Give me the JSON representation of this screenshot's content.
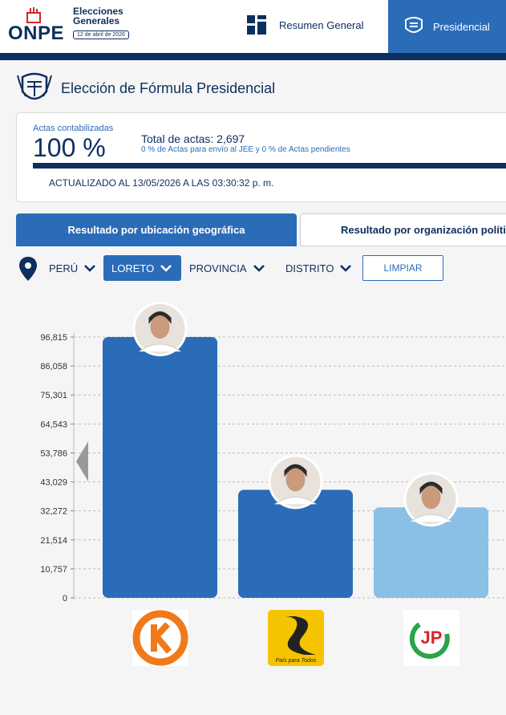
{
  "header": {
    "logo_text": "ONPE",
    "election_title": "Elecciones Generales",
    "election_date": "12 de abril de 2026",
    "nav_resumen": "Resumen General",
    "nav_presidencial": "Presidencial"
  },
  "page": {
    "title": "Elección de Fórmula Presidencial"
  },
  "summary": {
    "actas_label": "Actas contabilizadas",
    "actas_pct": "100 %",
    "total_label": "Total de actas: 2,697",
    "total_sub": "0 % de Actas para envío al JEE y 0 % de Actas pendientes",
    "progress": 1.0,
    "updated": "ACTUALIZADO AL 13/05/2026 A LAS 03:30:32 p. m."
  },
  "tabs": {
    "geo": "Resultado por ubicación geográfica",
    "org": "Resultado por organización política"
  },
  "filters": {
    "peru": "PERÚ",
    "loreto": "LORETO",
    "provincia": "PROVINCIA",
    "distrito": "DISTRITO",
    "clear": "LIMPIAR"
  },
  "colors": {
    "navy": "#0d2f5e",
    "blue": "#2b6cb8",
    "light_blue": "#8abfe6"
  },
  "chart_data": {
    "type": "bar",
    "categories": [
      "",
      "",
      ""
    ],
    "values": [
      96815,
      40100,
      33600
    ],
    "bar_colors": [
      "#2b6cb8",
      "#2b6cb8",
      "#8abfe6"
    ],
    "yticks": [
      "0",
      "10,757",
      "21,514",
      "32,272",
      "43,029",
      "53,786",
      "64,543",
      "75,301",
      "86,058",
      "96,815"
    ],
    "ylim": [
      0,
      96815
    ],
    "title": "",
    "xlabel": "",
    "ylabel": "",
    "grid": true,
    "party_logo_text": "País para Todos"
  }
}
